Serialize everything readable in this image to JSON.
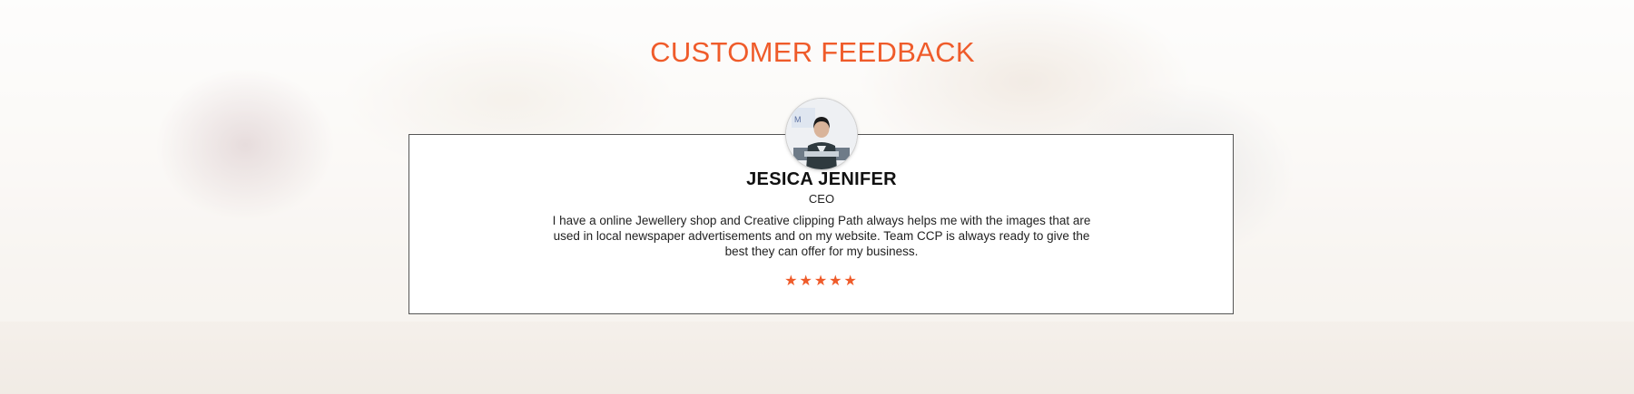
{
  "section": {
    "heading": "CUSTOMER FEEDBACK"
  },
  "testimonial": {
    "name": "JESICA JENIFER",
    "role": "CEO",
    "quote": "I have a online Jewellery shop and Creative clipping Path always helps me with the images that are used in local newspaper advertisements and on my website. Team CCP is always ready to give the best they can offer for my business.",
    "avatar_icon": "person-photo",
    "rating": {
      "stars": 5,
      "out_of": 5,
      "glyph": "★",
      "icon": "star-icon"
    }
  },
  "colors": {
    "accent": "#ef5b2a",
    "card_border": "#555555",
    "text": "#222222"
  }
}
